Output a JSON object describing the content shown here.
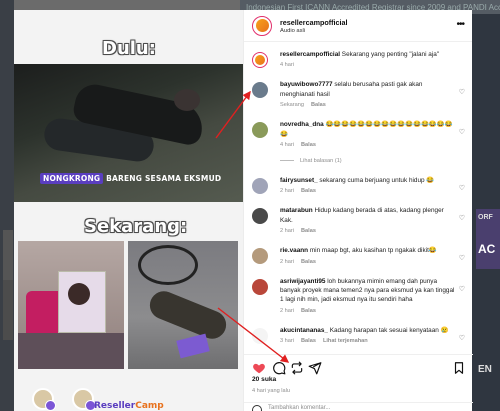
{
  "background": {
    "top_text": "Indonesian First ICANN Accredited Registrar since 2009 and PANDI Accredited",
    "right_label_1": "ORF",
    "right_label_2": "AC",
    "right_label_3": "EN"
  },
  "post_image": {
    "heading_before": "Dulu:",
    "caption_highlight": "NONGKRONG",
    "caption_rest": " BARENG SESAMA EKSMUD",
    "heading_after": "Sekarang:",
    "logo_part1": "Reseller",
    "logo_part2": "Camp"
  },
  "header": {
    "username": "resellercampofficial",
    "audio": "Audio asli"
  },
  "caption": {
    "username": "resellercampofficial",
    "text": " Sekarang yang penting \"jalani aja\"",
    "time": "4 hari"
  },
  "comments": [
    {
      "username": "bayuwibowo7777",
      "text": " selalu berusaha pasti gak akan menghianati hasil",
      "time": "Sekarang",
      "reply": "Balas",
      "extra": "",
      "color": "#6a7b8c"
    },
    {
      "username": "novredha_dna",
      "text": " 😂😂😂😂😂😂😂😂😂😂😂😂😂😂😂😂😂",
      "time": "4 hari",
      "reply": "Balas",
      "extra": "",
      "color": "#8a9a5a",
      "view_replies": "Lihat balasan (1)"
    },
    {
      "username": "fairysunset_",
      "text": " sekarang cuma berjuang untuk hidup 😂",
      "time": "2 hari",
      "reply": "Balas",
      "extra": "",
      "color": "#a0a4b8"
    },
    {
      "username": "matarabun",
      "text": " Hidup kadang berada di atas, kadang plenger Kak.",
      "time": "2 hari",
      "reply": "Balas",
      "extra": "",
      "color": "#4a4a4a"
    },
    {
      "username": "rie.vaann",
      "text": " min maap bgt, aku kasihan tp ngakak dikit😂",
      "time": "2 hari",
      "reply": "Balas",
      "extra": "",
      "color": "#b49a7c"
    },
    {
      "username": "asriwijayanti95",
      "text": " loh bukannya mimin emang dah punya banyak proyek mana temen2 nya para eksmud ya kan tinggal 1 lagi nih min, jadi eksmud nya itu sendiri haha",
      "time": "2 hari",
      "reply": "Balas",
      "extra": "",
      "color": "#b9473a"
    },
    {
      "username": "akucintananas_",
      "text": " Kadang harapan tak sesuai kenyataan 😢",
      "time": "3 hari",
      "reply": "Balas",
      "extra": "Lihat terjemahan",
      "color": "#f4f4f4"
    }
  ],
  "footer": {
    "likes": "20 suka",
    "ago": "4 hari yang lalu",
    "add_comment": "Tambahkan komentar..."
  },
  "colors": {
    "like_red": "#ed4956",
    "brand_purple": "#5a3ec0",
    "arrow_red": "#e02020"
  }
}
